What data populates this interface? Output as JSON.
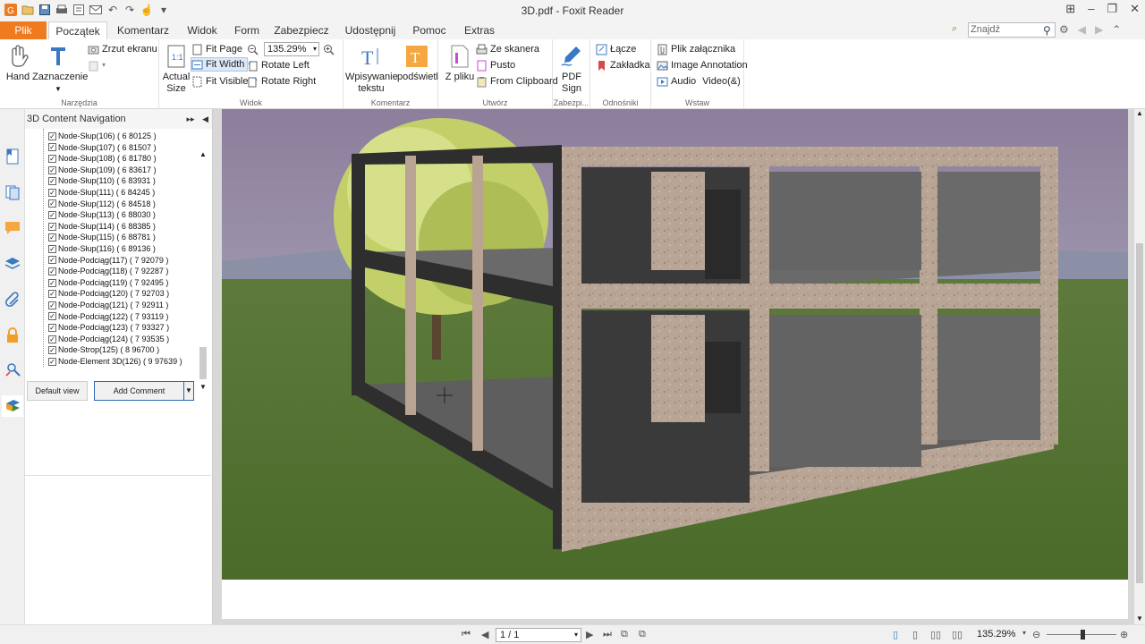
{
  "window": {
    "title": "3D.pdf - Foxit Reader"
  },
  "tabs": [
    {
      "label": "Plik"
    },
    {
      "label": "Początek"
    },
    {
      "label": "Komentarz"
    },
    {
      "label": "Widok"
    },
    {
      "label": "Form"
    },
    {
      "label": "Zabezpiecz"
    },
    {
      "label": "Udostępnij"
    },
    {
      "label": "Pomoc"
    },
    {
      "label": "Extras"
    }
  ],
  "search": {
    "placeholder": "Znajdź"
  },
  "ribbon": {
    "tools": {
      "hand": "Hand",
      "select": "Zaznaczenie",
      "snapshot": "Zrzut ekranu",
      "group": "Narzędzia"
    },
    "view": {
      "actual_size_1": "Actual",
      "actual_size_2": "Size",
      "fit_page": "Fit Page",
      "fit_width": "Fit Width",
      "fit_visible": "Fit Visible",
      "zoom": "135.29%",
      "rotate_left": "Rotate Left",
      "rotate_right": "Rotate Right",
      "group": "Widok"
    },
    "comment": {
      "typewriter_1": "Wpisywanie",
      "typewriter_2": "tekstu",
      "highlight": "podświetl",
      "group": "Komentarz"
    },
    "create": {
      "from_file": "Z pliku",
      "from_scanner": "Ze skanera",
      "blank": "Pusto",
      "from_clipboard": "From Clipboard",
      "group": "Utwórz"
    },
    "protect": {
      "pdf_sign_1": "PDF",
      "pdf_sign_2": "Sign",
      "group": "Zabezpi..."
    },
    "links": {
      "link": "Łącze",
      "bookmark": "Zakładka",
      "group": "Odnośniki"
    },
    "insert": {
      "attachment": "Plik załącznika",
      "image": "Image Annotation",
      "audio": "Audio",
      "video": "Video(&)",
      "group": "Wstaw"
    }
  },
  "nav_panel": {
    "title": "3D Content Navigation",
    "nodes": [
      "Node-Słup(106) ( 6 80125 )",
      "Node-Słup(107) ( 6 81507 )",
      "Node-Słup(108) ( 6 81780 )",
      "Node-Słup(109) ( 6 83617 )",
      "Node-Słup(110) ( 6 83931 )",
      "Node-Słup(111) ( 6 84245 )",
      "Node-Słup(112) ( 6 84518 )",
      "Node-Słup(113) ( 6 88030 )",
      "Node-Słup(114) ( 6 88385 )",
      "Node-Słup(115) ( 6 88781 )",
      "Node-Słup(116) ( 6 89136 )",
      "Node-Podciąg(117) ( 7 92079 )",
      "Node-Podciąg(118) ( 7 92287 )",
      "Node-Podciąg(119) ( 7 92495 )",
      "Node-Podciąg(120) ( 7 92703 )",
      "Node-Podciąg(121) ( 7 92911 )",
      "Node-Podciąg(122) ( 7 93119 )",
      "Node-Podciąg(123) ( 7 93327 )",
      "Node-Podciąg(124) ( 7 93535 )",
      "Node-Strop(125) ( 8 96700 )",
      "Node-Element 3D(126) ( 9 97639 )"
    ],
    "default_view": "Default view",
    "add_comment": "Add Comment"
  },
  "status": {
    "page": "1 / 1",
    "zoom": "135.29%"
  },
  "colors": {
    "accent": "#f07a1e",
    "active_blue": "#2a68b0"
  }
}
